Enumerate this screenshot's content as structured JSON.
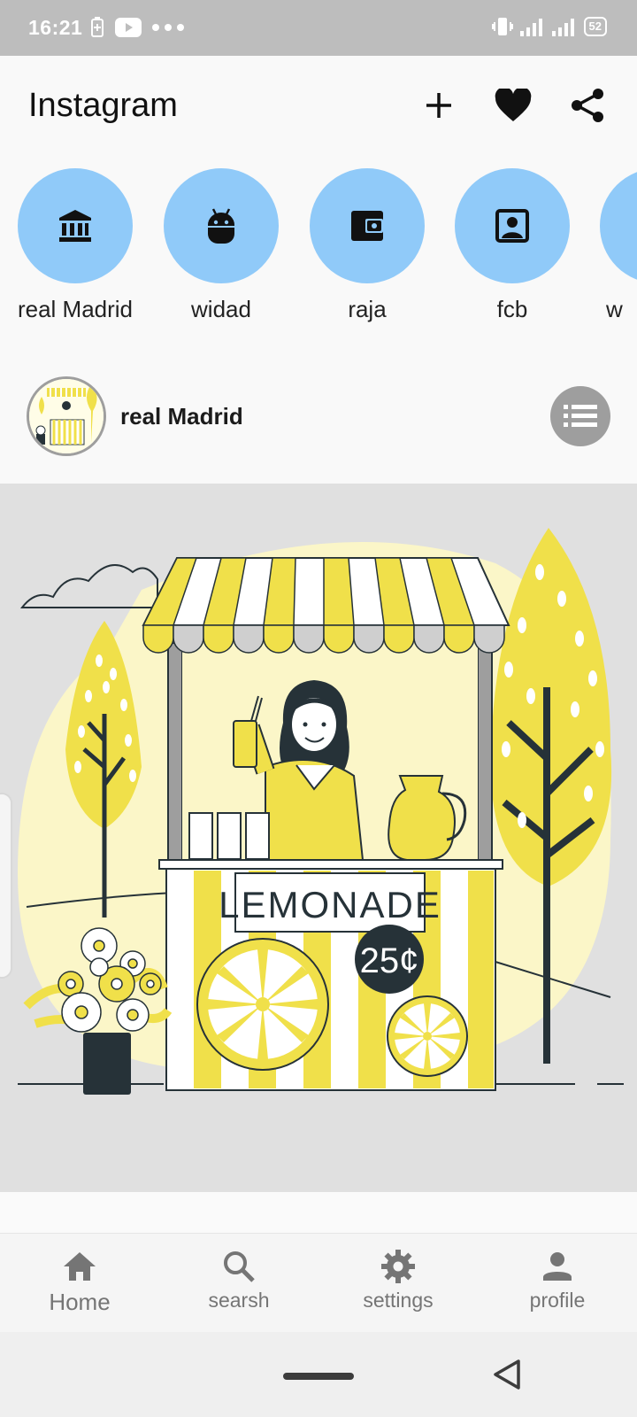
{
  "status_bar": {
    "time": "16:21",
    "battery": "52"
  },
  "app_bar": {
    "title": "Instagram",
    "actions": [
      "add-icon",
      "heart-icon",
      "share-icon"
    ]
  },
  "stories": [
    {
      "label": "real Madrid",
      "icon": "bank-icon"
    },
    {
      "label": "widad",
      "icon": "android-icon"
    },
    {
      "label": "raja",
      "icon": "wallet-icon"
    },
    {
      "label": "fcb",
      "icon": "contact-icon"
    },
    {
      "label": "w",
      "icon": ""
    }
  ],
  "post": {
    "username": "real Madrid",
    "menu_icon": "list-icon",
    "image": {
      "sign_text": "LEMONADE",
      "price_text": "25¢"
    }
  },
  "bottom_nav": {
    "items": [
      {
        "label": "Home",
        "icon": "home-icon",
        "active": true
      },
      {
        "label": "searsh",
        "icon": "search-icon",
        "active": false
      },
      {
        "label": "settings",
        "icon": "gear-icon",
        "active": false
      },
      {
        "label": "profile",
        "icon": "person-icon",
        "active": false
      }
    ]
  },
  "colors": {
    "status_bar": "#bdbdbd",
    "story_circle": "#90caf9",
    "nav_icon": "#757575",
    "lemon_yellow": "#f0e04a"
  }
}
